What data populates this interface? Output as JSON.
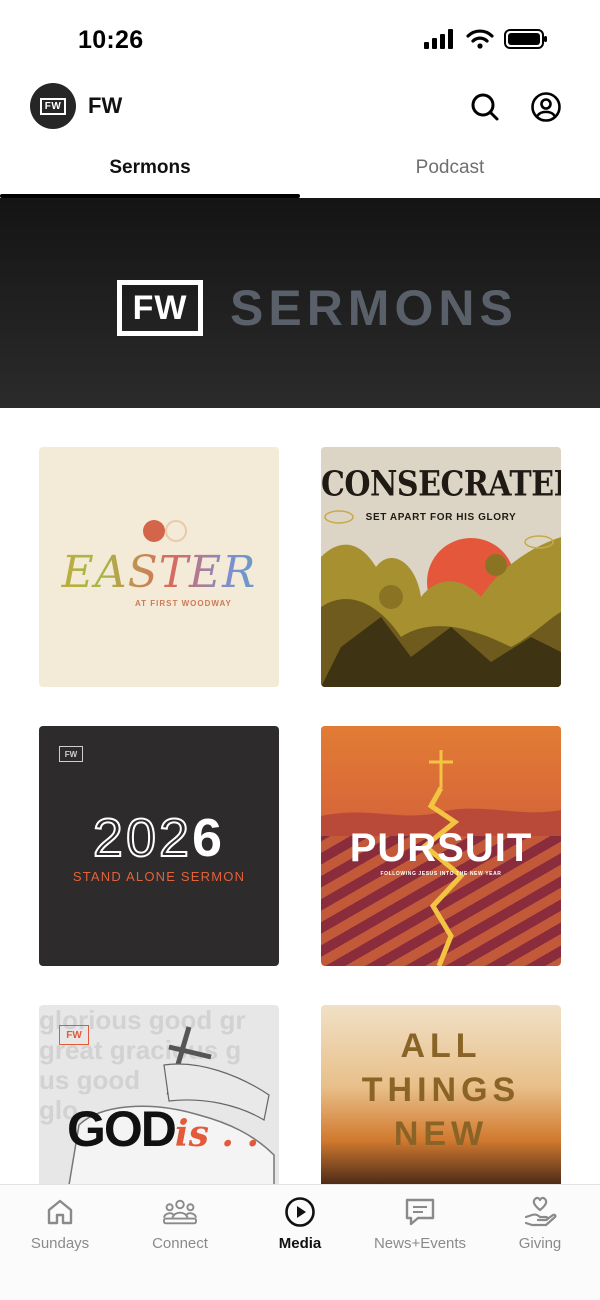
{
  "status_bar": {
    "time": "10:26"
  },
  "header": {
    "logo_text": "FW",
    "title": "FW"
  },
  "tabs": [
    {
      "label": "Sermons",
      "active": true
    },
    {
      "label": "Podcast",
      "active": false
    }
  ],
  "banner": {
    "logo_text": "FW",
    "title": "SERMONS"
  },
  "series": [
    {
      "id": "easter",
      "title": "EASTER",
      "subtitle": "AT FIRST WOODWAY"
    },
    {
      "id": "consecrated",
      "title": "CONSECRATED",
      "subtitle": "SET APART FOR HIS GLORY"
    },
    {
      "id": "2026",
      "logo_text": "FW",
      "year_outline": "20",
      "year_mid": "2",
      "year_solid": "6",
      "subtitle": "STAND ALONE SERMON"
    },
    {
      "id": "pursuit",
      "title": "PURSUIT",
      "subtitle": "FOLLOWING JESUS INTO THE NEW YEAR"
    },
    {
      "id": "god-is",
      "logo_text": "FW",
      "title_main": "GOD",
      "title_accent": "is . . .",
      "bg_words": [
        "glorious good gr",
        "great gracious g",
        "us good",
        "glo"
      ]
    },
    {
      "id": "all-things-new",
      "lines": [
        "ALL",
        "THINGS",
        "NEW"
      ]
    }
  ],
  "bottom_nav": [
    {
      "label": "Sundays",
      "icon": "home-icon",
      "active": false
    },
    {
      "label": "Connect",
      "icon": "people-icon",
      "active": false
    },
    {
      "label": "Media",
      "icon": "play-circle-icon",
      "active": true
    },
    {
      "label": "News+Events",
      "icon": "message-icon",
      "active": false
    },
    {
      "label": "Giving",
      "icon": "hand-heart-icon",
      "active": false
    }
  ],
  "colors": {
    "accent": "#e2623a",
    "active_text": "#111111",
    "inactive_text": "#8a8a8a"
  }
}
